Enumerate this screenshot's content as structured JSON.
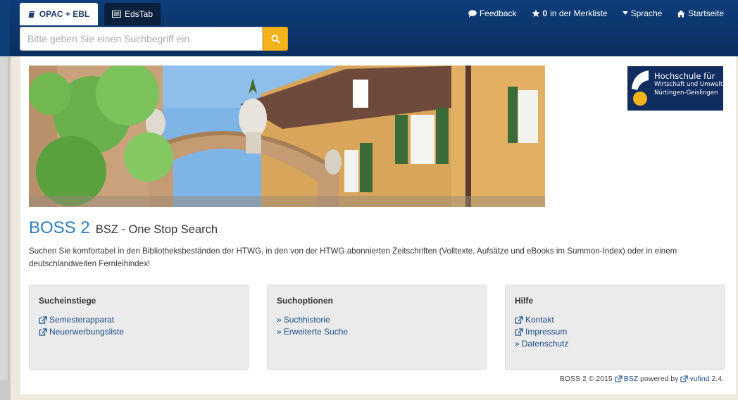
{
  "tabs": [
    {
      "label": "OPAC + EBL",
      "icon": "book-icon",
      "active": true
    },
    {
      "label": "EdsTab",
      "icon": "newspaper-icon",
      "active": false
    }
  ],
  "search": {
    "placeholder": "Bitte geben Sie einen Suchbegriff ein",
    "value": ""
  },
  "topnav": {
    "feedback": "Feedback",
    "favorites_count": "0",
    "favorites_label": "in der Merkliste",
    "language": "Sprache",
    "home": "Startseite"
  },
  "logo": {
    "line1": "Hochschule für",
    "line2": "Wirtschaft und Umwelt",
    "line3": "Nürtingen-Geislingen"
  },
  "heading": {
    "main": "BOSS 2",
    "sub": "BSZ - One Stop Search"
  },
  "description": "Suchen Sie komfortabel in den Bibliotheksbeständen der HTWG, in den von der HTWG abonnierten Zeitschriften (Volltexte, Aufsätze und eBooks im Summon-Index) oder in einem deutschlandweiten Fernleihindex!",
  "boxes": [
    {
      "title": "Sucheinstiege",
      "links": [
        {
          "label": "Semesterapparat",
          "prefix": "external"
        },
        {
          "label": "Neuerwerbungsliste",
          "prefix": "external"
        }
      ]
    },
    {
      "title": "Suchoptionen",
      "links": [
        {
          "label": "Suchhistorie",
          "prefix": "raquo"
        },
        {
          "label": "Erweiterte Suche",
          "prefix": "raquo"
        }
      ]
    },
    {
      "title": "Hilfe",
      "links": [
        {
          "label": "Kontakt",
          "prefix": "external"
        },
        {
          "label": "Impressum",
          "prefix": "external"
        },
        {
          "label": "Datenschutz",
          "prefix": "raquo"
        }
      ]
    }
  ],
  "footer": {
    "prefix": "BOSS 2 © 2015",
    "bsz": "BSZ",
    "powered": "powered by",
    "vufind": "vufind",
    "version": "2.4."
  },
  "colors": {
    "header": "#0d3d7a",
    "accent": "#f5b31b",
    "link": "#1b4f8a",
    "title": "#2a7ec0"
  }
}
